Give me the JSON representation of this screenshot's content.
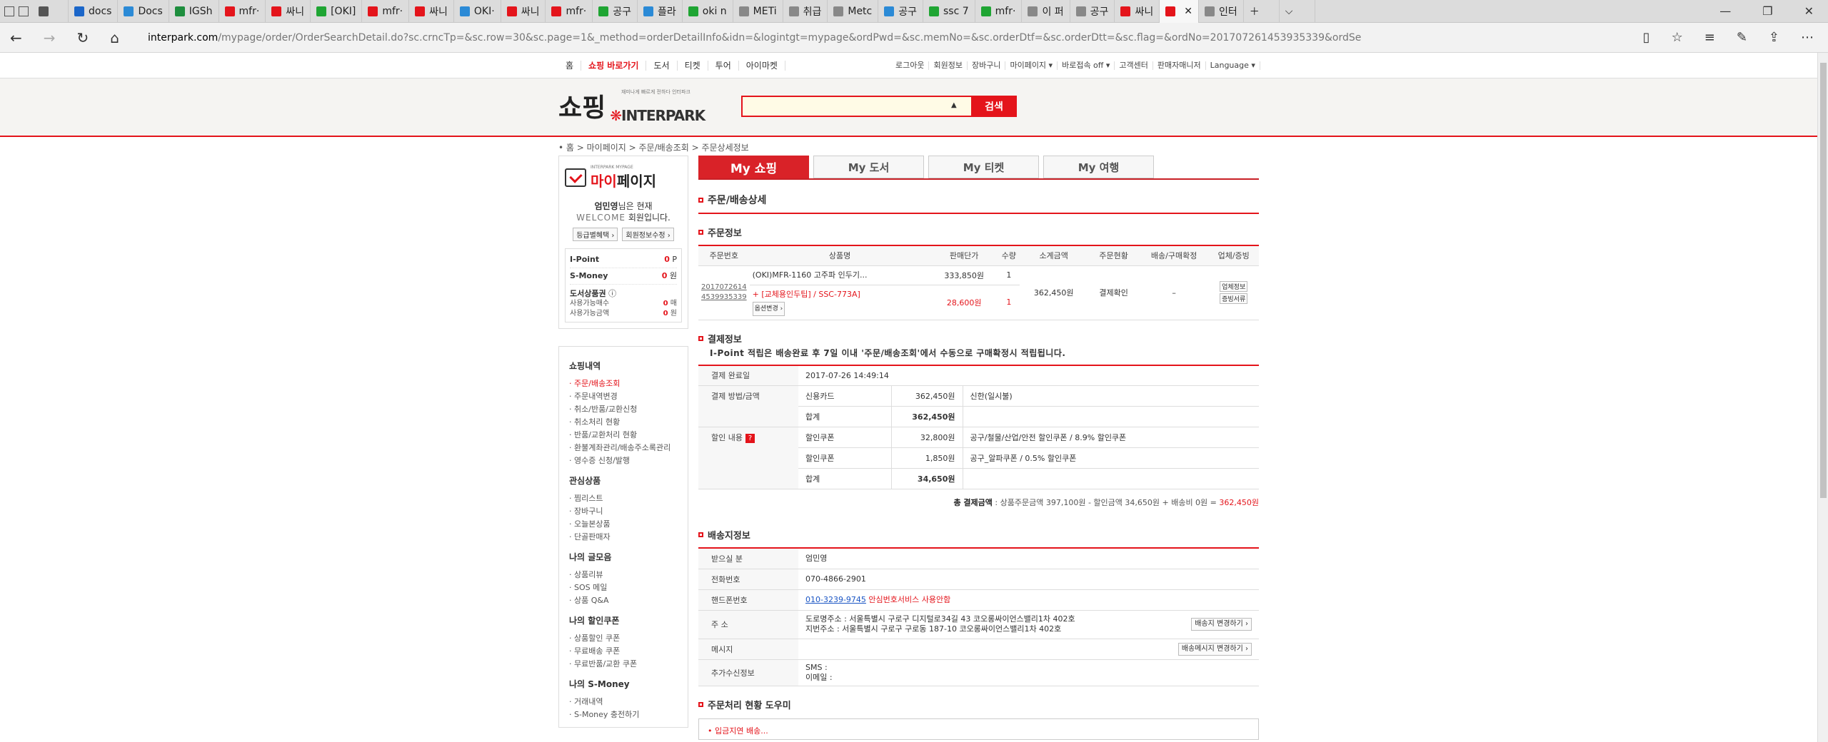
{
  "browser": {
    "tabs": [
      {
        "label": "",
        "color": "#555",
        "active": false
      },
      {
        "label": "docs",
        "color": "#1b66c9",
        "active": false
      },
      {
        "label": "Docs",
        "color": "#2b8ad6",
        "active": false
      },
      {
        "label": "IGSh",
        "color": "#1e8e3e",
        "active": false
      },
      {
        "label": "mfr·",
        "color": "#e4141b",
        "active": false
      },
      {
        "label": "싸니",
        "color": "#e4141b",
        "active": false
      },
      {
        "label": "[OKI]",
        "color": "#1fa533",
        "active": false
      },
      {
        "label": "mfr·",
        "color": "#e4141b",
        "active": false
      },
      {
        "label": "싸니",
        "color": "#e4141b",
        "active": false
      },
      {
        "label": "OKI·",
        "color": "#2b8ad6",
        "active": false
      },
      {
        "label": "싸니",
        "color": "#e4141b",
        "active": false
      },
      {
        "label": "mfr·",
        "color": "#e4141b",
        "active": false
      },
      {
        "label": "공구",
        "color": "#1fa533",
        "active": false
      },
      {
        "label": "플라",
        "color": "#2b8ad6",
        "active": false
      },
      {
        "label": "oki n",
        "color": "#1fa533",
        "active": false
      },
      {
        "label": "METi",
        "color": "#888",
        "active": false
      },
      {
        "label": "취급",
        "color": "#888",
        "active": false
      },
      {
        "label": "Metc",
        "color": "#888",
        "active": false
      },
      {
        "label": "공구",
        "color": "#2b8ad6",
        "active": false
      },
      {
        "label": "ssc 7",
        "color": "#1fa533",
        "active": false
      },
      {
        "label": "mfr·",
        "color": "#1fa533",
        "active": false
      },
      {
        "label": "이 퍼",
        "color": "#888",
        "active": false
      },
      {
        "label": "공구",
        "color": "#888",
        "active": false
      },
      {
        "label": "싸니",
        "color": "#e4141b",
        "active": false
      },
      {
        "label": "",
        "color": "#e4141b",
        "active": true
      },
      {
        "label": "인터",
        "color": "#888",
        "active": false
      }
    ],
    "url_domain": "interpark.com",
    "url_path": "/mypage/order/OrderSearchDetail.do?sc.crncTp=&sc.row=30&sc.page=1&_method=orderDetailInfo&idn=&logintgt=mypage&ordPwd=&sc.memNo=&sc.orderDtf=&sc.orderDtt=&sc.flag=&ordNo=20170726145393533​9&ordSeq=&prdNo=&startMon=&startDay=&startYear="
  },
  "gnb": {
    "left": [
      "홈",
      "쇼핑 바로가기",
      "도서",
      "티켓",
      "투어",
      "아이마켓"
    ],
    "right": [
      "로그아웃",
      "회원정보",
      "장바구니",
      "마이페이지 ▾",
      "바로접속 off ▾",
      "고객센터",
      "판매자매니저",
      "Language ▾"
    ]
  },
  "header": {
    "logo_shop": "쇼핑",
    "logo_brand": "INTERPARK",
    "logo_tag": "재미나게 빠르게 전하다 인터파크",
    "search_btn": "검색",
    "search_placeholder": ""
  },
  "breadcrumb": "• 홈 > 마이페이지 > 주문/배송조회 > 주문상세정보",
  "sidebar": {
    "mypage_small": "INTERPARK MYPAGE",
    "mypage_title_a": "마이",
    "mypage_title_b": "페이지",
    "user_name": "엄민영",
    "welcome_suffix": "님은 현재",
    "welcome_grade": "WELCOME",
    "welcome_tail": "회원입니다.",
    "btn_grade": "등급별혜택 ›",
    "btn_info": "회원정보수정 ›",
    "ipoint_label": "I-Point",
    "ipoint_value": "0",
    "ipoint_unit": "P",
    "smoney_label": "S-Money",
    "smoney_value": "0",
    "smoney_unit": "원",
    "book_label": "도서상품권",
    "book_count_label": "사용가능매수",
    "book_count": "0",
    "book_count_unit": "매",
    "book_amt_label": "사용가능금액",
    "book_amt": "0",
    "book_amt_unit": "원",
    "sections": [
      {
        "title": "쇼핑내역",
        "items": [
          "주문/배송조회",
          "주문내역변경",
          "취소/반품/교환신청",
          "취소처리 현황",
          "반품/교환처리 현황",
          "환불계좌관리/배송주소록관리",
          "영수증 신청/발행"
        ]
      },
      {
        "title": "관심상품",
        "items": [
          "찜리스트",
          "장바구니",
          "오늘본상품",
          "단골판매자"
        ]
      },
      {
        "title": "나의 글모음",
        "items": [
          "상품리뷰",
          "SOS 메일",
          "상품 Q&A"
        ]
      },
      {
        "title": "나의 할인쿠폰",
        "items": [
          "상품할인 쿠폰",
          "무료배송 쿠폰",
          "무료반품/교환 쿠폰"
        ]
      },
      {
        "title": "나의 S-Money",
        "items": [
          "거래내역",
          "S-Money 충전하기"
        ]
      }
    ]
  },
  "main": {
    "tabs": [
      "My 쇼핑",
      "My 도서",
      "My 티켓",
      "My 여행"
    ],
    "title": "주문/배송상세",
    "order_section": "주문정보",
    "order_headers": [
      "주문번호",
      "상품명",
      "판매단가",
      "수량",
      "소계금액",
      "주문현황",
      "배송/구매확정",
      "업체/증빙"
    ],
    "order_no_a": "20170726​14",
    "order_no_b": "4539935339",
    "item1_name": "(OKI)MFR-1160 고주파 인두기...",
    "item1_price": "333,850원",
    "item1_qty": "1",
    "item2_name": "+ [교체용인두팁] / SSC-773A]",
    "item2_price": "28,600원",
    "item2_qty": "1",
    "option_btn": "옵션변경 ›",
    "subtotal": "362,450원",
    "status": "결제확인",
    "ship_status": "–",
    "btn_vendor": "업체정보",
    "btn_receipt": "증빙서류",
    "pay_section": "결제정보",
    "pay_note": "I-Point 적립은 배송완료 후 7일 이내 '주문/배송조회'에서 수동으로 구매확정시 적립됩니다.",
    "pay_done_label": "결제 완료일",
    "pay_done": "2017-07-26 14:49:14",
    "pay_method_label": "결제 방법/금액",
    "pay_card_label": "신용카드",
    "pay_card_amt": "362,450원",
    "pay_card_detail": "신한(일시불)",
    "pay_sum_label": "합계",
    "pay_sum": "362,450원",
    "disc_label": "할인 내용",
    "disc1_label": "할인쿠폰",
    "disc1_amt": "32,800원",
    "disc1_detail": "공구/철물/산업/안전 할인쿠폰 / 8.9% 할인쿠폰",
    "disc2_label": "할인쿠폰",
    "disc2_amt": "1,850원",
    "disc2_detail": "공구_알파쿠폰 / 0.5% 할인쿠폰",
    "disc_sum_label": "합계",
    "disc_sum": "34,650원",
    "total_label": "총 결제금액",
    "total_text": " : 상품주문금액 397,100원 - 할인금액 34,650원 + 배송비 0원 = ",
    "total_value": "362,450원",
    "ship_section": "배송지정보",
    "recv_label": "받으실 분",
    "recv_name": "엄민영",
    "tel_label": "전화번호",
    "tel": "070-4866-2901",
    "hp_label": "핸드폰번호",
    "hp": "010-3239-9745",
    "hp_note": " 안심번호서비스 사용안함",
    "addr_label": "주    소",
    "addr_road": "도로명주소 : 서울특별시 구로구 디지털로34길 43 코오롱싸이언스밸리1차 402호",
    "addr_lot": "지번주소 : 서울특별시 구로구 구로동 187-10 코오롱싸이언스밸리1차 402호",
    "addr_btn": "배송지 변경하기 ›",
    "msg_label": "메시지",
    "msg_btn": "배송메시지 변경하기 ›",
    "extra_label": "추가수신정보",
    "extra_sms": "SMS :",
    "extra_email": "이메일 :",
    "help_section": "주문처리 현황 도우미",
    "help_text": "• 입금지연 배송..."
  }
}
